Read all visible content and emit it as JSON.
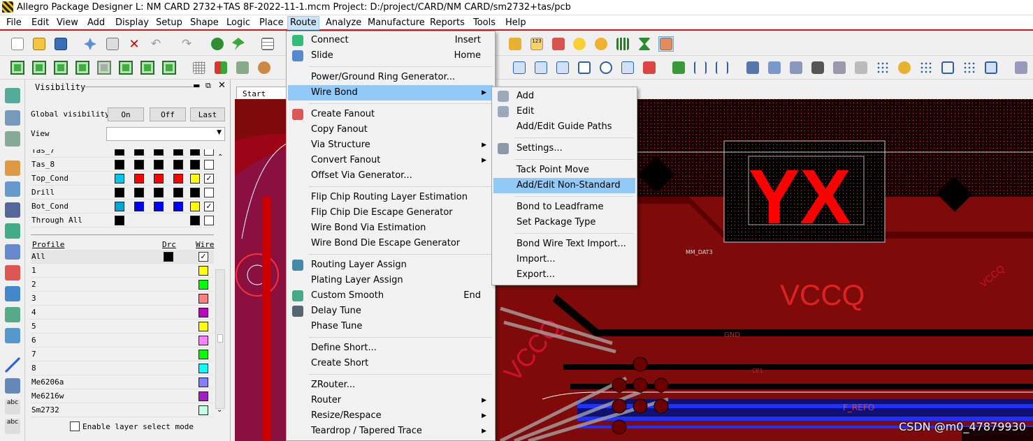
{
  "window": {
    "title": "Allegro Package Designer L: NM CARD 2732+TAS 8F-2022-11-1.mcm  Project: D:/project/CARD/NM CARD/sm2732+tas/pcb"
  },
  "menubar": [
    "File",
    "Edit",
    "View",
    "Add",
    "Display",
    "Setup",
    "Shape",
    "Logic",
    "Place",
    "Route",
    "Analyze",
    "Manufacture",
    "Reports",
    "Tools",
    "Help"
  ],
  "visibility": {
    "title": "Visibility",
    "global_label": "Global visibility",
    "on": "On",
    "off": "Off",
    "last": "Last",
    "view_label": "View",
    "layers": [
      {
        "name": "Tas_7",
        "colors": [
          "#000000",
          "#000000",
          "#000000",
          "#000000",
          "#000000"
        ],
        "checked": false
      },
      {
        "name": "Tas_8",
        "colors": [
          "#000000",
          "#000000",
          "#000000",
          "#000000",
          "#000000"
        ],
        "checked": false
      },
      {
        "name": "Top_Cond",
        "colors": [
          "#00c8f0",
          "#ff0000",
          "#ff0000",
          "#ff0000",
          "#ffff00"
        ],
        "checked": true
      },
      {
        "name": "Drill",
        "colors": [
          "#000000",
          "#000000",
          "#000000",
          "#000000",
          "#000000"
        ],
        "checked": false
      },
      {
        "name": "Bot_Cond",
        "colors": [
          "#00a8d8",
          "#0000ff",
          "#0000ff",
          "#0000ff",
          "#ffff00"
        ],
        "checked": true
      },
      {
        "name": "Through All",
        "colors": [
          "#000000",
          "",
          "",
          "",
          "#000000"
        ],
        "checked": false
      }
    ],
    "profile_header": "Profile",
    "drc_header": "Drc",
    "wire_header": "Wire",
    "profiles": [
      {
        "name": "All",
        "drc": "#000000",
        "wire": "check"
      },
      {
        "name": "1",
        "wire": "#ffff00"
      },
      {
        "name": "2",
        "wire": "#00ff00"
      },
      {
        "name": "3",
        "wire": "#ff8080"
      },
      {
        "name": "4",
        "wire": "#c000c0"
      },
      {
        "name": "5",
        "wire": "#ffff00"
      },
      {
        "name": "6",
        "wire": "#ff80ff"
      },
      {
        "name": "7",
        "wire": "#00ff00"
      },
      {
        "name": "8",
        "wire": "#00ffff"
      },
      {
        "name": "Me6206a",
        "wire": "#8080ff"
      },
      {
        "name": "Me6216w",
        "wire": "#a020c0"
      },
      {
        "name": "Sm2732",
        "wire": "#c0ffe0"
      }
    ],
    "enable_layer_select": "Enable layer select mode"
  },
  "start_tab": "Start Page",
  "route_menu": [
    {
      "label": "Connect",
      "key": "Insert",
      "icon": "connect-icon"
    },
    {
      "label": "Slide",
      "key": "Home",
      "icon": "slide-icon"
    },
    {
      "sep": true
    },
    {
      "label": "Power/Ground Ring Generator..."
    },
    {
      "label": "Wire Bond",
      "submenu": true,
      "highlight": true
    },
    {
      "sep": true
    },
    {
      "label": "Create Fanout",
      "icon": "fanout-icon"
    },
    {
      "label": "Copy Fanout"
    },
    {
      "label": "Via Structure",
      "submenu": true
    },
    {
      "label": "Convert Fanout",
      "submenu": true
    },
    {
      "label": "Offset Via Generator..."
    },
    {
      "sep": true
    },
    {
      "label": "Flip Chip Routing Layer Estimation"
    },
    {
      "label": "Flip Chip Die Escape Generator"
    },
    {
      "label": "Wire Bond Via Estimation"
    },
    {
      "label": "Wire Bond Die Escape Generator"
    },
    {
      "sep": true
    },
    {
      "label": "Routing Layer Assign",
      "icon": "layer-assign-icon"
    },
    {
      "label": "Plating Layer Assign"
    },
    {
      "label": "Custom Smooth",
      "key": "End",
      "icon": "smooth-icon"
    },
    {
      "label": "Delay Tune",
      "icon": "delay-tune-icon"
    },
    {
      "label": "Phase Tune"
    },
    {
      "sep": true
    },
    {
      "label": "Define Short..."
    },
    {
      "label": "Create Short"
    },
    {
      "sep": true
    },
    {
      "label": "ZRouter..."
    },
    {
      "label": "Router",
      "submenu": true
    },
    {
      "label": "Resize/Respace",
      "submenu": true
    },
    {
      "label": "Teardrop / Tapered Trace",
      "submenu": true
    }
  ],
  "wirebond_menu": [
    {
      "label": "Add",
      "icon": "wirebond-add-icon"
    },
    {
      "label": "Edit",
      "icon": "wirebond-edit-icon"
    },
    {
      "label": "Add/Edit Guide Paths"
    },
    {
      "sep": true
    },
    {
      "label": "Settings...",
      "icon": "settings-icon"
    },
    {
      "sep": true
    },
    {
      "label": "Tack Point Move"
    },
    {
      "label": "Add/Edit Non-Standard",
      "highlight": true
    },
    {
      "sep": true
    },
    {
      "label": "Bond to Leadframe"
    },
    {
      "label": "Set Package Type"
    },
    {
      "sep": true
    },
    {
      "label": "Bond Wire Text Import..."
    },
    {
      "label": "Import..."
    },
    {
      "label": "Export..."
    }
  ],
  "canvas_labels": {
    "yx": "YX",
    "vccq_big": "VCCQ",
    "vccq_left": "VCCQ",
    "vccq_right": "VCCQ",
    "net1": "MM_DAT3",
    "gnd": "GND",
    "ce": "CE1",
    "f_refo": "F_REFO"
  },
  "watermark": "CSDN @m0_47879930"
}
